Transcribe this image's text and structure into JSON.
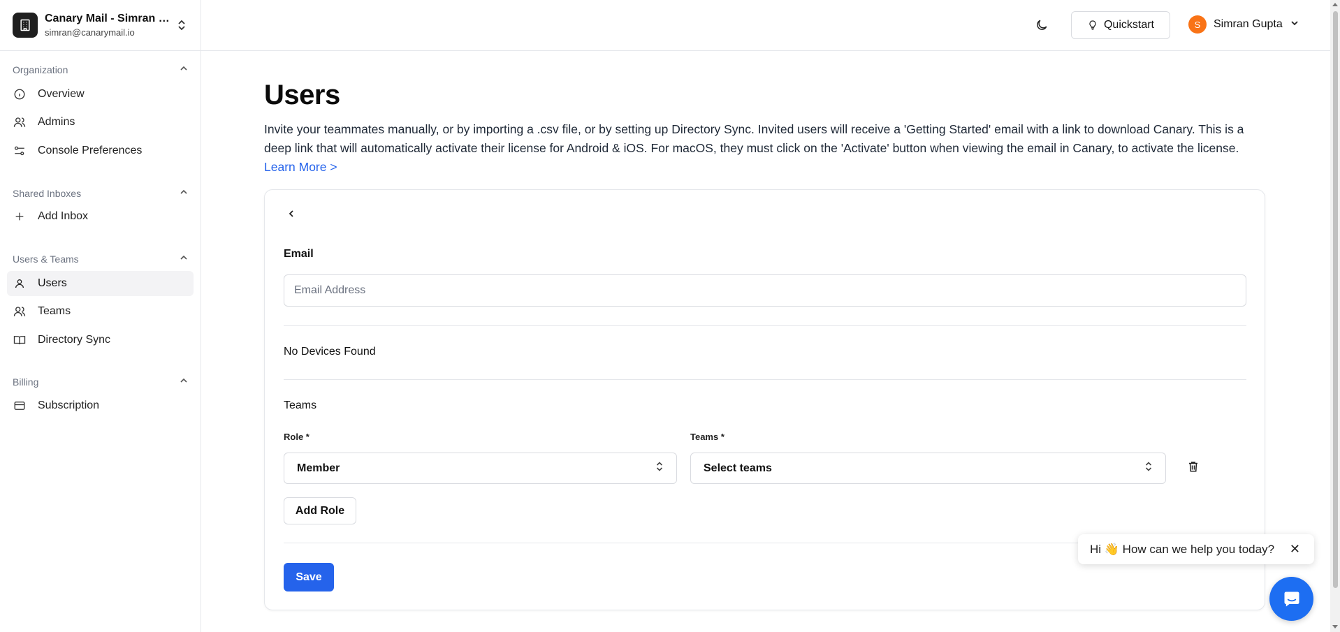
{
  "org": {
    "name": "Canary Mail - Simran -...",
    "email": "simran@canarymail.io"
  },
  "sidebar": {
    "sections": [
      {
        "title": "Organization",
        "items": [
          {
            "label": "Overview"
          },
          {
            "label": "Admins"
          },
          {
            "label": "Console Preferences"
          }
        ]
      },
      {
        "title": "Shared Inboxes",
        "items": [
          {
            "label": "Add Inbox"
          }
        ]
      },
      {
        "title": "Users & Teams",
        "items": [
          {
            "label": "Users"
          },
          {
            "label": "Teams"
          },
          {
            "label": "Directory Sync"
          }
        ]
      },
      {
        "title": "Billing",
        "items": [
          {
            "label": "Subscription"
          }
        ]
      }
    ],
    "active_item": "Users"
  },
  "header": {
    "quickstart_label": "Quickstart",
    "user_initial": "S",
    "user_name": "Simran Gupta"
  },
  "main": {
    "title": "Users",
    "description": "Invite your teammates manually, or by importing a .csv file, or by setting up Directory Sync. Invited users will receive a 'Getting Started' email with a link to download Canary. This is a deep link that will automatically activate their license for Android & iOS. For macOS, they must click on the 'Activate' button when viewing the email in Canary, to activate the license.",
    "learn_more": "Learn More >",
    "form": {
      "email_label": "Email",
      "email_value": "",
      "email_placeholder": "Email Address",
      "devices_text": "No Devices Found",
      "teams_heading": "Teams",
      "role_label": "Role *",
      "role_value": "Member",
      "teams_label": "Teams *",
      "teams_value": "Select teams",
      "add_role_label": "Add Role",
      "save_label": "Save"
    }
  },
  "chat": {
    "greeting": "Hi 👋 How can we help you today?",
    "close_glyph": "✕"
  },
  "colors": {
    "primary": "#2563eb",
    "avatar": "#f97316",
    "chat": "#1d6ef2"
  }
}
